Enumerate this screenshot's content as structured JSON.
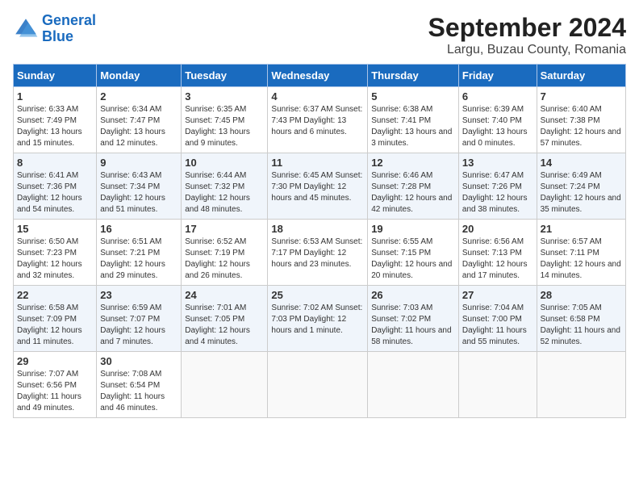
{
  "logo": {
    "line1": "General",
    "line2": "Blue"
  },
  "title": "September 2024",
  "subtitle": "Largu, Buzau County, Romania",
  "headers": [
    "Sunday",
    "Monday",
    "Tuesday",
    "Wednesday",
    "Thursday",
    "Friday",
    "Saturday"
  ],
  "weeks": [
    [
      {
        "day": "1",
        "info": "Sunrise: 6:33 AM\nSunset: 7:49 PM\nDaylight: 13 hours\nand 15 minutes."
      },
      {
        "day": "2",
        "info": "Sunrise: 6:34 AM\nSunset: 7:47 PM\nDaylight: 13 hours\nand 12 minutes."
      },
      {
        "day": "3",
        "info": "Sunrise: 6:35 AM\nSunset: 7:45 PM\nDaylight: 13 hours\nand 9 minutes."
      },
      {
        "day": "4",
        "info": "Sunrise: 6:37 AM\nSunset: 7:43 PM\nDaylight: 13 hours\nand 6 minutes."
      },
      {
        "day": "5",
        "info": "Sunrise: 6:38 AM\nSunset: 7:41 PM\nDaylight: 13 hours\nand 3 minutes."
      },
      {
        "day": "6",
        "info": "Sunrise: 6:39 AM\nSunset: 7:40 PM\nDaylight: 13 hours\nand 0 minutes."
      },
      {
        "day": "7",
        "info": "Sunrise: 6:40 AM\nSunset: 7:38 PM\nDaylight: 12 hours\nand 57 minutes."
      }
    ],
    [
      {
        "day": "8",
        "info": "Sunrise: 6:41 AM\nSunset: 7:36 PM\nDaylight: 12 hours\nand 54 minutes."
      },
      {
        "day": "9",
        "info": "Sunrise: 6:43 AM\nSunset: 7:34 PM\nDaylight: 12 hours\nand 51 minutes."
      },
      {
        "day": "10",
        "info": "Sunrise: 6:44 AM\nSunset: 7:32 PM\nDaylight: 12 hours\nand 48 minutes."
      },
      {
        "day": "11",
        "info": "Sunrise: 6:45 AM\nSunset: 7:30 PM\nDaylight: 12 hours\nand 45 minutes."
      },
      {
        "day": "12",
        "info": "Sunrise: 6:46 AM\nSunset: 7:28 PM\nDaylight: 12 hours\nand 42 minutes."
      },
      {
        "day": "13",
        "info": "Sunrise: 6:47 AM\nSunset: 7:26 PM\nDaylight: 12 hours\nand 38 minutes."
      },
      {
        "day": "14",
        "info": "Sunrise: 6:49 AM\nSunset: 7:24 PM\nDaylight: 12 hours\nand 35 minutes."
      }
    ],
    [
      {
        "day": "15",
        "info": "Sunrise: 6:50 AM\nSunset: 7:23 PM\nDaylight: 12 hours\nand 32 minutes."
      },
      {
        "day": "16",
        "info": "Sunrise: 6:51 AM\nSunset: 7:21 PM\nDaylight: 12 hours\nand 29 minutes."
      },
      {
        "day": "17",
        "info": "Sunrise: 6:52 AM\nSunset: 7:19 PM\nDaylight: 12 hours\nand 26 minutes."
      },
      {
        "day": "18",
        "info": "Sunrise: 6:53 AM\nSunset: 7:17 PM\nDaylight: 12 hours\nand 23 minutes."
      },
      {
        "day": "19",
        "info": "Sunrise: 6:55 AM\nSunset: 7:15 PM\nDaylight: 12 hours\nand 20 minutes."
      },
      {
        "day": "20",
        "info": "Sunrise: 6:56 AM\nSunset: 7:13 PM\nDaylight: 12 hours\nand 17 minutes."
      },
      {
        "day": "21",
        "info": "Sunrise: 6:57 AM\nSunset: 7:11 PM\nDaylight: 12 hours\nand 14 minutes."
      }
    ],
    [
      {
        "day": "22",
        "info": "Sunrise: 6:58 AM\nSunset: 7:09 PM\nDaylight: 12 hours\nand 11 minutes."
      },
      {
        "day": "23",
        "info": "Sunrise: 6:59 AM\nSunset: 7:07 PM\nDaylight: 12 hours\nand 7 minutes."
      },
      {
        "day": "24",
        "info": "Sunrise: 7:01 AM\nSunset: 7:05 PM\nDaylight: 12 hours\nand 4 minutes."
      },
      {
        "day": "25",
        "info": "Sunrise: 7:02 AM\nSunset: 7:03 PM\nDaylight: 12 hours\nand 1 minute."
      },
      {
        "day": "26",
        "info": "Sunrise: 7:03 AM\nSunset: 7:02 PM\nDaylight: 11 hours\nand 58 minutes."
      },
      {
        "day": "27",
        "info": "Sunrise: 7:04 AM\nSunset: 7:00 PM\nDaylight: 11 hours\nand 55 minutes."
      },
      {
        "day": "28",
        "info": "Sunrise: 7:05 AM\nSunset: 6:58 PM\nDaylight: 11 hours\nand 52 minutes."
      }
    ],
    [
      {
        "day": "29",
        "info": "Sunrise: 7:07 AM\nSunset: 6:56 PM\nDaylight: 11 hours\nand 49 minutes."
      },
      {
        "day": "30",
        "info": "Sunrise: 7:08 AM\nSunset: 6:54 PM\nDaylight: 11 hours\nand 46 minutes."
      },
      {
        "day": "",
        "info": ""
      },
      {
        "day": "",
        "info": ""
      },
      {
        "day": "",
        "info": ""
      },
      {
        "day": "",
        "info": ""
      },
      {
        "day": "",
        "info": ""
      }
    ]
  ]
}
